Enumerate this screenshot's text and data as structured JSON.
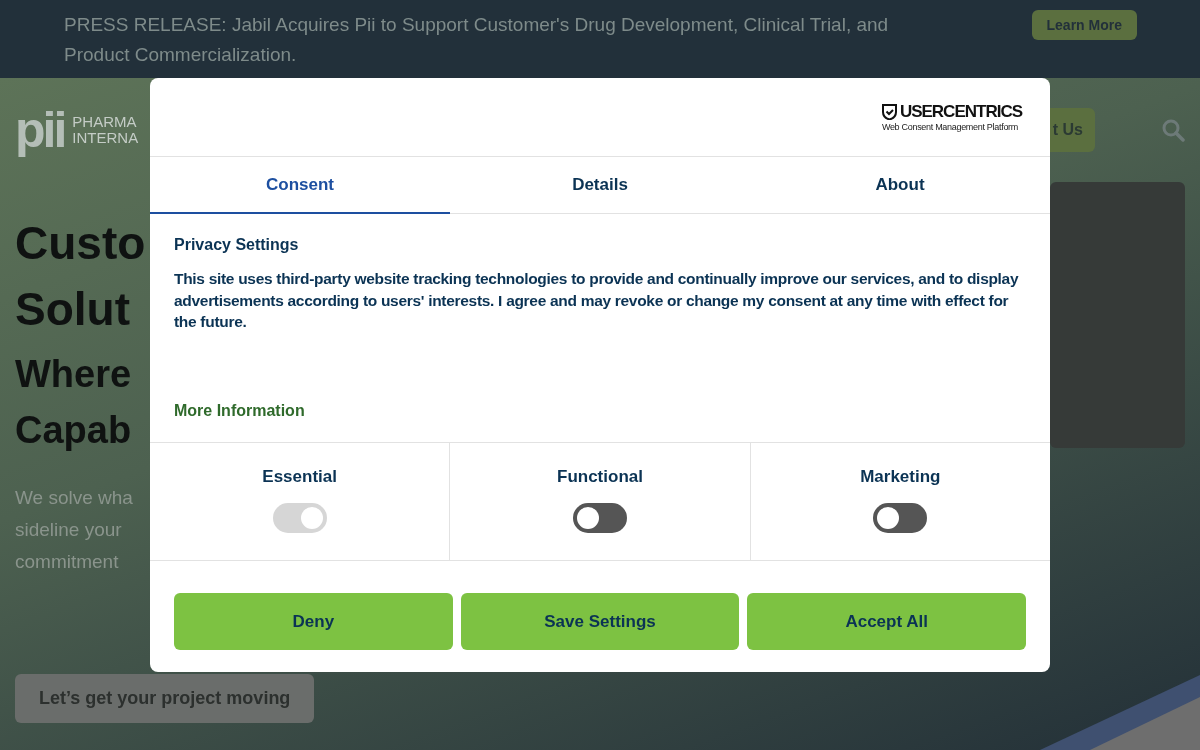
{
  "banner": {
    "text": "PRESS RELEASE: Jabil Acquires Pii to Support Customer's Drug Development, Clinical Trial, and Product Commercialization.",
    "button": "Learn More"
  },
  "header": {
    "logo_mark": "pii",
    "logo_lines": [
      "PHARMA",
      "INTERNA"
    ],
    "contact_button": "t Us"
  },
  "hero": {
    "title_lines": [
      "Custo",
      "Solut"
    ],
    "subtitle_lines": [
      "Where",
      "Capab"
    ],
    "text_lines": [
      "We solve wha",
      "sideline your",
      "commitment"
    ],
    "button": "Let’s get your project moving"
  },
  "modal": {
    "brand": {
      "name": "USERCENTRICS",
      "tagline": "Web Consent Management Platform"
    },
    "tabs": [
      {
        "label": "Consent",
        "selected": true
      },
      {
        "label": "Details",
        "selected": false
      },
      {
        "label": "About",
        "selected": false
      }
    ],
    "heading": "Privacy Settings",
    "body": "This site uses third-party website tracking technologies to provide and continually improve our services, and to display advertisements according to users' interests. I agree and may revoke or change my consent at any time with effect for the future.",
    "more_link": "More Information",
    "categories": [
      {
        "label": "Essential",
        "checked": true,
        "disabled": true
      },
      {
        "label": "Functional",
        "checked": false,
        "disabled": false
      },
      {
        "label": "Marketing",
        "checked": false,
        "disabled": false
      }
    ],
    "buttons": [
      "Deny",
      "Save Settings",
      "Accept All"
    ]
  }
}
